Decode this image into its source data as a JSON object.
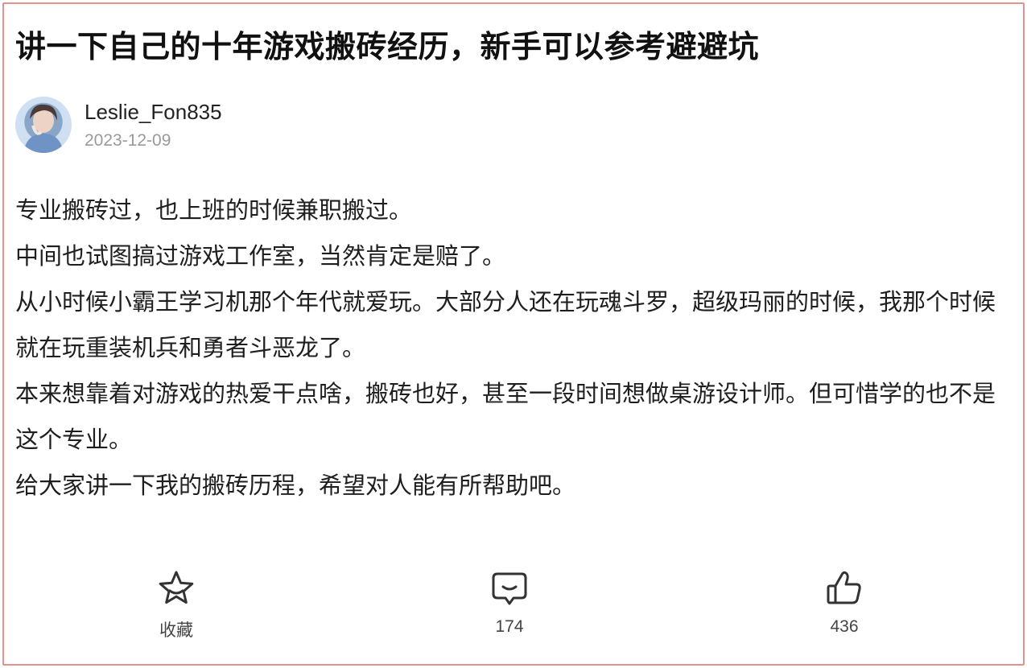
{
  "post": {
    "title": "讲一下自己的十年游戏搬砖经历，新手可以参考避避坑",
    "author": {
      "name": "Leslie_Fon835",
      "date": "2023-12-09",
      "avatar_icon": "avatar-icon"
    },
    "paragraphs": [
      "专业搬砖过，也上班的时候兼职搬过。",
      "中间也试图搞过游戏工作室，当然肯定是赔了。",
      "从小时候小霸王学习机那个年代就爱玩。大部分人还在玩魂斗罗，超级玛丽的时候，我那个时候就在玩重装机兵和勇者斗恶龙了。",
      "本来想靠着对游戏的热爱干点啥，搬砖也好，甚至一段时间想做桌游设计师。但可惜学的也不是这个专业。",
      "给大家讲一下我的搬砖历程，希望对人能有所帮助吧。"
    ]
  },
  "actions": {
    "favorite": {
      "label": "收藏",
      "icon": "star-icon"
    },
    "comment": {
      "count": "174",
      "icon": "comment-icon"
    },
    "like": {
      "count": "436",
      "icon": "thumbs-up-icon"
    }
  },
  "colors": {
    "frame_border": "#e5928f",
    "icon_stroke": "#333333",
    "date_text": "#9a9a9a"
  }
}
